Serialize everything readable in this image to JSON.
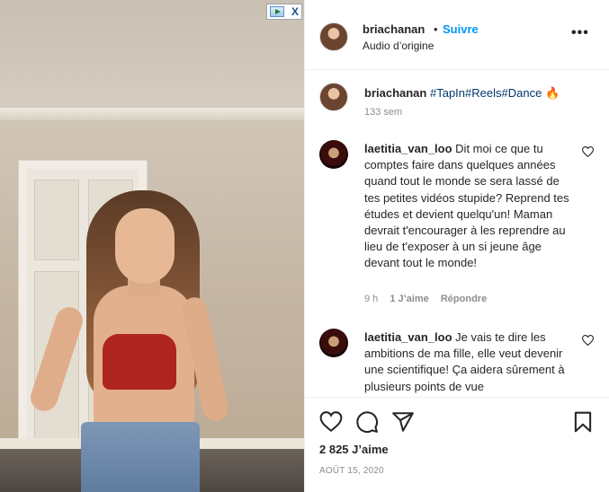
{
  "ad_badge": {
    "play_icon": "ad-play-icon",
    "close_label": "X"
  },
  "header": {
    "username": "briachanan",
    "separator": "•",
    "follow_label": "Suivre",
    "subtitle": "Audio d’origine",
    "more_label": "•••"
  },
  "caption": {
    "username": "briachanan",
    "tags": [
      "#TapIn",
      "#Reels",
      "#Dance"
    ],
    "emoji": "🔥",
    "time": "133 sem"
  },
  "comments": [
    {
      "username": "laetitia_van_loo",
      "text": "Dit moi ce que tu comptes faire dans quelques années quand tout le monde se sera lassé de tes petites vidéos stupide? Reprend tes études et devient quelqu'un! Maman devrait t'encourager à les reprendre au lieu de t'exposer à un si jeune âge devant tout le monde!",
      "time": "9 h",
      "likes": "1 J’aime",
      "reply_label": "Répondre"
    },
    {
      "username": "laetitia_van_loo",
      "text": "Je vais te dire les ambitions de ma fille, elle veut devenir une scientifique! Ça aidera sûrement à plusieurs points de vue"
    }
  ],
  "actions": {
    "icons": [
      "heart-icon",
      "comment-icon",
      "share-icon",
      "bookmark-icon"
    ],
    "likes": "2 825 J’aime",
    "date": "AOÛT 15, 2020"
  },
  "colors": {
    "link_blue": "#0095f6",
    "tag_blue": "#00376b",
    "muted": "#8e8e8e",
    "text": "#262626"
  }
}
